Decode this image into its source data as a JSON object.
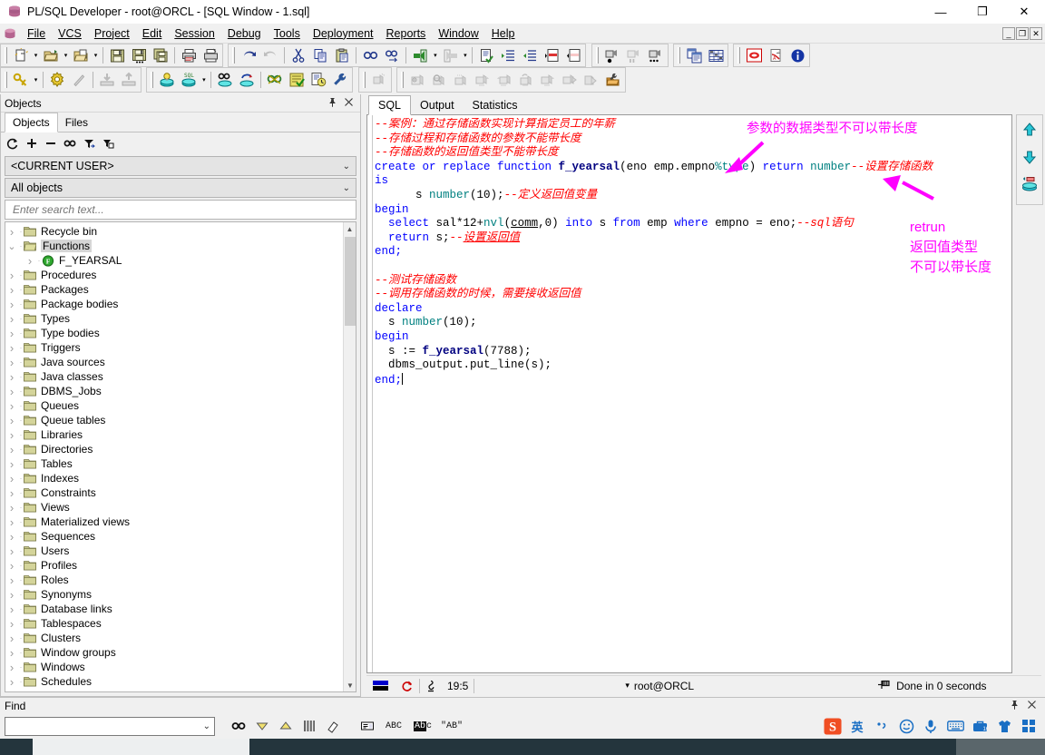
{
  "window": {
    "title": "PL/SQL Developer - root@ORCL - [SQL Window - 1.sql]",
    "icon": "database-icon",
    "minimize": "—",
    "maximize": "❐",
    "close": "✕",
    "mdi_restore": "❐",
    "mdi_minimize": "_",
    "mdi_close": "✕"
  },
  "menu": {
    "items": [
      {
        "label": "File"
      },
      {
        "label": "VCS"
      },
      {
        "label": "Project"
      },
      {
        "label": "Edit"
      },
      {
        "label": "Session"
      },
      {
        "label": "Debug"
      },
      {
        "label": "Tools"
      },
      {
        "label": "Deployment"
      },
      {
        "label": "Reports"
      },
      {
        "label": "Window"
      },
      {
        "label": "Help"
      }
    ]
  },
  "objects_panel": {
    "caption": "Objects",
    "pin_icon": "pin-icon",
    "close_icon": "close-icon",
    "tabs": [
      {
        "label": "Objects",
        "active": true
      },
      {
        "label": "Files",
        "active": false
      }
    ],
    "toolbar_icons": [
      "refresh-icon",
      "expand-all-icon",
      "collapse-all-icon",
      "find-icon",
      "filter-icon",
      "copy-name-icon"
    ],
    "user_filter": "<CURRENT USER>",
    "object_filter": "All objects",
    "search_placeholder": "Enter search text...",
    "search_value": "",
    "tree": [
      {
        "label": "Recycle bin",
        "level": 1,
        "expanded": false,
        "type": "folder"
      },
      {
        "label": "Functions",
        "level": 1,
        "expanded": true,
        "type": "folder",
        "selected": true
      },
      {
        "label": "F_YEARSAL",
        "level": 2,
        "expanded": false,
        "type": "function"
      },
      {
        "label": "Procedures",
        "level": 1,
        "expanded": false,
        "type": "folder"
      },
      {
        "label": "Packages",
        "level": 1,
        "expanded": false,
        "type": "folder"
      },
      {
        "label": "Package bodies",
        "level": 1,
        "expanded": false,
        "type": "folder"
      },
      {
        "label": "Types",
        "level": 1,
        "expanded": false,
        "type": "folder"
      },
      {
        "label": "Type bodies",
        "level": 1,
        "expanded": false,
        "type": "folder"
      },
      {
        "label": "Triggers",
        "level": 1,
        "expanded": false,
        "type": "folder"
      },
      {
        "label": "Java sources",
        "level": 1,
        "expanded": false,
        "type": "folder"
      },
      {
        "label": "Java classes",
        "level": 1,
        "expanded": false,
        "type": "folder"
      },
      {
        "label": "DBMS_Jobs",
        "level": 1,
        "expanded": false,
        "type": "folder"
      },
      {
        "label": "Queues",
        "level": 1,
        "expanded": false,
        "type": "folder"
      },
      {
        "label": "Queue tables",
        "level": 1,
        "expanded": false,
        "type": "folder"
      },
      {
        "label": "Libraries",
        "level": 1,
        "expanded": false,
        "type": "folder"
      },
      {
        "label": "Directories",
        "level": 1,
        "expanded": false,
        "type": "folder"
      },
      {
        "label": "Tables",
        "level": 1,
        "expanded": false,
        "type": "folder"
      },
      {
        "label": "Indexes",
        "level": 1,
        "expanded": false,
        "type": "folder"
      },
      {
        "label": "Constraints",
        "level": 1,
        "expanded": false,
        "type": "folder"
      },
      {
        "label": "Views",
        "level": 1,
        "expanded": false,
        "type": "folder"
      },
      {
        "label": "Materialized views",
        "level": 1,
        "expanded": false,
        "type": "folder"
      },
      {
        "label": "Sequences",
        "level": 1,
        "expanded": false,
        "type": "folder"
      },
      {
        "label": "Users",
        "level": 1,
        "expanded": false,
        "type": "folder"
      },
      {
        "label": "Profiles",
        "level": 1,
        "expanded": false,
        "type": "folder"
      },
      {
        "label": "Roles",
        "level": 1,
        "expanded": false,
        "type": "folder"
      },
      {
        "label": "Synonyms",
        "level": 1,
        "expanded": false,
        "type": "folder"
      },
      {
        "label": "Database links",
        "level": 1,
        "expanded": false,
        "type": "folder"
      },
      {
        "label": "Tablespaces",
        "level": 1,
        "expanded": false,
        "type": "folder"
      },
      {
        "label": "Clusters",
        "level": 1,
        "expanded": false,
        "type": "folder"
      },
      {
        "label": "Window groups",
        "level": 1,
        "expanded": false,
        "type": "folder"
      },
      {
        "label": "Windows",
        "level": 1,
        "expanded": false,
        "type": "folder"
      },
      {
        "label": "Schedules",
        "level": 1,
        "expanded": false,
        "type": "folder"
      }
    ]
  },
  "sql_window": {
    "tabs": [
      {
        "label": "SQL",
        "active": true
      },
      {
        "label": "Output",
        "active": false
      },
      {
        "label": "Statistics",
        "active": false
      }
    ],
    "code_lines": [
      "--案例：通过存储函数实现计算指定员工的年薪",
      "--存储过程和存储函数的参数不能带长度",
      "--存储函数的返回值类型不能带长度",
      "create or replace function f_yearsal(eno emp.empno%type) return number--设置存储函数",
      "is",
      "      s number(10);--定义返回值变量",
      "begin",
      "  select sal*12+nvl(comm,0) into s from emp where empno = eno;--sql语句",
      "  return s;--设置返回值",
      "end;",
      "",
      "--测试存储函数",
      "--调用存储函数的时候，需要接收返回值",
      "declare",
      "  s number(10);",
      "begin",
      "  s := f_yearsal(7788);",
      "  dbms_output.put_line(s);",
      "end;"
    ],
    "annotations": [
      {
        "text": "参数的数据类型不可以带长度",
        "color": "#ff00ff"
      },
      {
        "text": "retrun",
        "color": "#ff00ff"
      },
      {
        "text": "返回值类型",
        "color": "#ff00ff"
      },
      {
        "text": "不可以带长度",
        "color": "#ff00ff"
      }
    ],
    "rail_icons": [
      "scroll-up-icon",
      "scroll-down-icon",
      "sql-history-icon"
    ],
    "status": {
      "record_icon": "record-indicator-icon",
      "refresh_icon": "refresh-icon",
      "lock_icon": "lock-icon",
      "cursor_position": "19:5",
      "connection": "root@ORCL",
      "connection_arrow": "▾",
      "result_icon": "pin-result-icon",
      "result_text": "Done in 0 seconds"
    }
  },
  "find_panel": {
    "caption": "Find",
    "pin_icon": "pin-icon",
    "close_icon": "close-icon",
    "input_value": "",
    "input_placeholder": "",
    "dropdown_arrow": "⌄",
    "buttons": [
      "find-icon",
      "find-next-icon",
      "find-previous-icon",
      "find-all-icon",
      "clear-icon",
      "search-in-icon",
      "whole-words-icon",
      "match-case-icon",
      "regex-icon"
    ]
  },
  "tray": {
    "items": [
      {
        "icon": "sogou-ime-icon",
        "label": "S"
      },
      {
        "icon": "ime-chinese-icon",
        "label": "英"
      },
      {
        "icon": "ime-punctuation-icon",
        "label": "，"
      },
      {
        "icon": "ime-emoji-icon",
        "label": "☺"
      },
      {
        "icon": "ime-voice-icon",
        "label": "🎤"
      },
      {
        "icon": "ime-keyboard-icon",
        "label": "⌨"
      },
      {
        "icon": "ime-toolbox-icon",
        "label": "🧰"
      },
      {
        "icon": "ime-skin-icon",
        "label": "👕"
      },
      {
        "icon": "ime-more-icon",
        "label": "▦"
      }
    ]
  },
  "colors": {
    "keyword": "#0000ff",
    "type": "#008080",
    "identifier": "#000080",
    "comment": "#ff0000",
    "annotation": "#ff00ff",
    "panel_bg": "#f0f0f0",
    "editor_bg": "#ffffff",
    "folder": "#c8c88c"
  }
}
